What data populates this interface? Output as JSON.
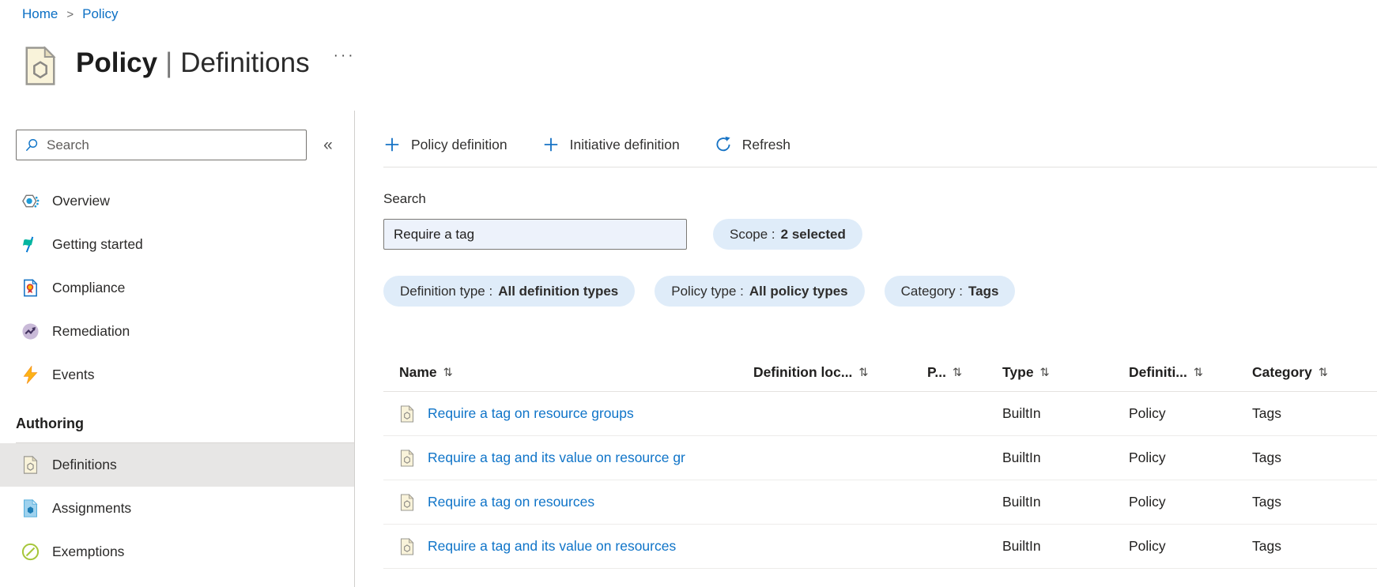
{
  "breadcrumb": {
    "separator": ">",
    "items": [
      {
        "label": "Home"
      },
      {
        "label": "Policy"
      }
    ]
  },
  "header": {
    "title_primary": "Policy",
    "title_separator": "|",
    "title_secondary": "Definitions",
    "more_icon": "···"
  },
  "sidebar": {
    "search_placeholder": "Search",
    "collapse_icon": "«",
    "items": [
      {
        "label": "Overview",
        "icon": "overview-icon"
      },
      {
        "label": "Getting started",
        "icon": "getting-started-icon"
      },
      {
        "label": "Compliance",
        "icon": "compliance-icon"
      },
      {
        "label": "Remediation",
        "icon": "remediation-icon"
      },
      {
        "label": "Events",
        "icon": "events-icon"
      }
    ],
    "section_title": "Authoring",
    "authoring_items": [
      {
        "label": "Definitions",
        "icon": "policy-definition-icon",
        "selected": true
      },
      {
        "label": "Assignments",
        "icon": "assignments-icon",
        "selected": false
      },
      {
        "label": "Exemptions",
        "icon": "exemptions-icon",
        "selected": false
      }
    ]
  },
  "toolbar": {
    "buttons": [
      {
        "label": "Policy definition",
        "icon": "plus-icon"
      },
      {
        "label": "Initiative definition",
        "icon": "plus-icon"
      },
      {
        "label": "Refresh",
        "icon": "refresh-icon"
      }
    ]
  },
  "filters": {
    "search_label": "Search",
    "search_value": "Require a tag",
    "scope": {
      "label": "Scope :",
      "value": "2 selected"
    },
    "pills": [
      {
        "label": "Definition type :",
        "value": "All definition types"
      },
      {
        "label": "Policy type :",
        "value": "All policy types"
      },
      {
        "label": "Category :",
        "value": "Tags"
      }
    ]
  },
  "table": {
    "sort_icon": "⇅",
    "columns": [
      {
        "label": "Name"
      },
      {
        "label": "Definition loc..."
      },
      {
        "label": "P..."
      },
      {
        "label": "Type"
      },
      {
        "label": "Definiti..."
      },
      {
        "label": "Category"
      }
    ],
    "rows": [
      {
        "name": "Require a tag on resource groups",
        "definition_location": "",
        "p": "",
        "type": "BuiltIn",
        "definition_type": "Policy",
        "category": "Tags"
      },
      {
        "name": "Require a tag and its value on resource gr",
        "definition_location": "",
        "p": "",
        "type": "BuiltIn",
        "definition_type": "Policy",
        "category": "Tags"
      },
      {
        "name": "Require a tag on resources",
        "definition_location": "",
        "p": "",
        "type": "BuiltIn",
        "definition_type": "Policy",
        "category": "Tags"
      },
      {
        "name": "Require a tag and its value on resources",
        "definition_location": "",
        "p": "",
        "type": "BuiltIn",
        "definition_type": "Policy",
        "category": "Tags"
      }
    ]
  },
  "colors": {
    "accent": "#0078d4",
    "link": "#0f74c8",
    "selected_bg": "#e7e6e5",
    "pill_bg": "#dfecf9",
    "input_bg": "#edf2fb",
    "policy_icon_fill": "#f9f3da"
  }
}
